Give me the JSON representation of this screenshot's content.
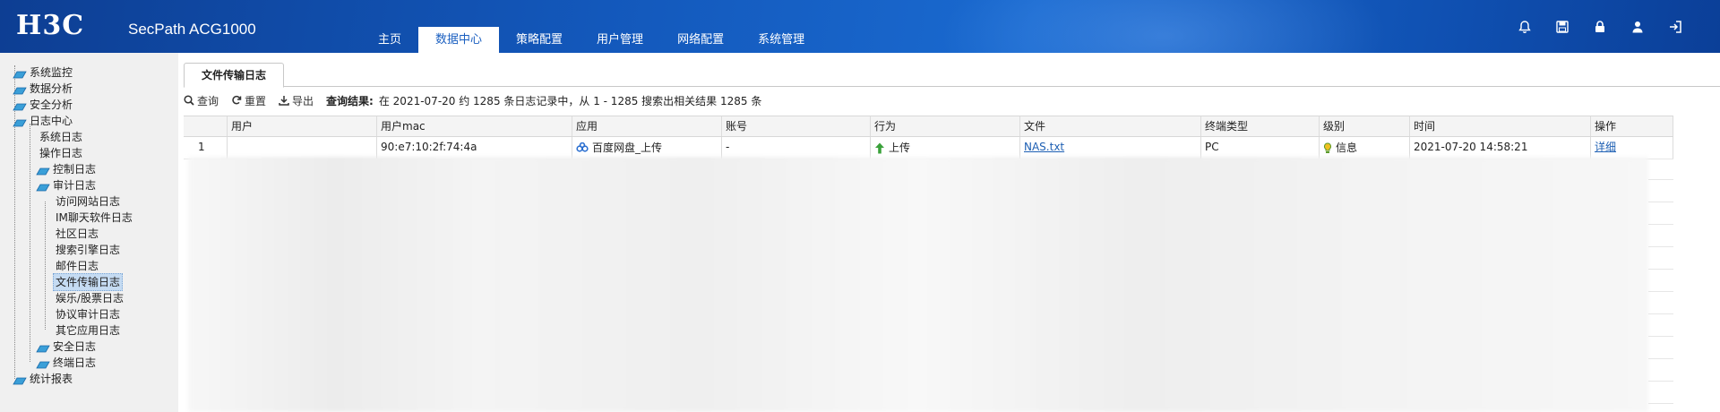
{
  "header": {
    "logo": "H3C",
    "product": "SecPath ACG1000",
    "nav": [
      "主页",
      "数据中心",
      "策略配置",
      "用户管理",
      "网络配置",
      "系统管理"
    ],
    "active_nav": "数据中心",
    "icons": [
      "bell-icon",
      "save-icon",
      "lock-icon",
      "user-icon",
      "logout-icon"
    ]
  },
  "sidebar": {
    "items": [
      {
        "label": "系统监控"
      },
      {
        "label": "数据分析"
      },
      {
        "label": "安全分析"
      },
      {
        "label": "日志中心"
      },
      {
        "label": "系统日志"
      },
      {
        "label": "操作日志"
      },
      {
        "label": "控制日志"
      },
      {
        "label": "审计日志"
      },
      {
        "label": "访问网站日志"
      },
      {
        "label": "IM聊天软件日志"
      },
      {
        "label": "社区日志"
      },
      {
        "label": "搜索引擎日志"
      },
      {
        "label": "邮件日志"
      },
      {
        "label": "文件传输日志"
      },
      {
        "label": "娱乐/股票日志"
      },
      {
        "label": "协议审计日志"
      },
      {
        "label": "其它应用日志"
      },
      {
        "label": "安全日志"
      },
      {
        "label": "终端日志"
      },
      {
        "label": "统计报表"
      }
    ]
  },
  "tab": {
    "label": "文件传输日志"
  },
  "toolbar": {
    "query": "查询",
    "reset": "重置",
    "export": "导出",
    "result_label": "查询结果:",
    "result_text": "在 2021-07-20 约 1285 条日志记录中，从 1 - 1285 搜索出相关结果 1285 条"
  },
  "table": {
    "columns": [
      "",
      "用户",
      "用户mac",
      "应用",
      "账号",
      "行为",
      "文件",
      "终端类型",
      "级别",
      "时间",
      "操作"
    ],
    "rows": [
      {
        "index": "1",
        "user": "",
        "mac": "90:e7:10:2f:74:4a",
        "app": "百度网盘_上传",
        "account": "-",
        "action": "上传",
        "file": "NAS.txt",
        "terminal": "PC",
        "level": "信息",
        "time": "2021-07-20 14:58:21",
        "op": "详细"
      }
    ]
  },
  "colors": {
    "accent": "#1a5fc0",
    "header_dark": "#0d3e93",
    "upload_green": "#3aa13a"
  }
}
